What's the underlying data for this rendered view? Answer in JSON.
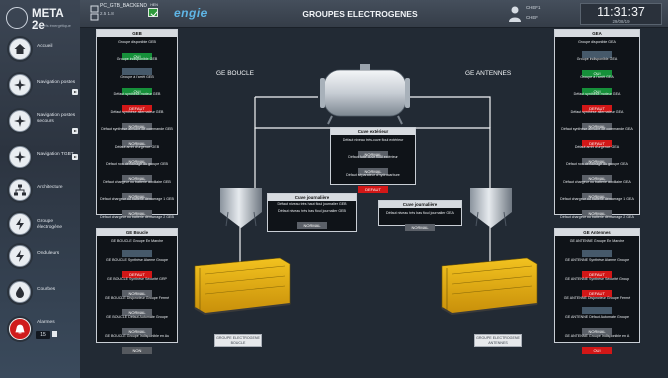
{
  "app": {
    "name": "META 2e",
    "subtitle": "aéronefs énergétique"
  },
  "sidebar": {
    "items": [
      {
        "label": "Accueil",
        "icon": "home-icon",
        "has_arrow": false
      },
      {
        "label": "Navigation postes",
        "icon": "compass-icon",
        "has_arrow": true
      },
      {
        "label": "Navigation postes secours",
        "icon": "compass-icon",
        "has_arrow": true
      },
      {
        "label": "Navigation TGBT",
        "icon": "compass-icon",
        "has_arrow": true
      },
      {
        "label": "Architecture",
        "icon": "network-icon",
        "has_arrow": false
      },
      {
        "label": "Groupe électrogène",
        "icon": "bolt-icon",
        "has_arrow": false
      },
      {
        "label": "Onduleurs",
        "icon": "bolt-icon",
        "has_arrow": false
      },
      {
        "label": "Courbes",
        "icon": "drop-icon",
        "has_arrow": false
      },
      {
        "label": "Alarmes",
        "icon": "alarm-bell-icon",
        "has_arrow": true
      }
    ],
    "alarm_count": "15"
  },
  "header": {
    "station_name": "PC_GTB_BACKEND",
    "version": "2.5  1.8",
    "flag_label": "HEN",
    "brand": "engie",
    "title": "GROUPES ELECTROGENES",
    "user_name": "CHEF1",
    "user_role": "CHEF",
    "time": "11:31:37",
    "date": "29/08/19"
  },
  "diagram": {
    "caption_left": "GE BOUCLE",
    "caption_right": "GE ANTENNES",
    "gen_left_label": "GROUPE ELECTROGENE BOUCLE",
    "gen_right_label": "GROUPE ELECTROGENE ANTENNES"
  },
  "panels": {
    "geb": {
      "title": "GEB",
      "signals": [
        {
          "label": "Groupe disponible GEB",
          "value": "OUI",
          "state": "ok"
        },
        {
          "label": "Groupe indisponible GEB",
          "value": "",
          "state": "blank"
        },
        {
          "label": "Groupe à l'arrêt GEB",
          "value": "OUI",
          "state": "ok"
        },
        {
          "label": "Défaut synthèse moteur GEB",
          "value": "DEFAUT",
          "state": "default"
        },
        {
          "label": "Défaut synthèse alternateur GEB",
          "value": "NORMAL",
          "state": "normal"
        },
        {
          "label": "Défaut synthèse armoire de commande GEB",
          "value": "NORMAL",
          "state": "normal"
        },
        {
          "label": "Défaut arrêt d'urgence GEB",
          "value": "NORMAL",
          "state": "normal"
        },
        {
          "label": "Défaut non démarrage du groupe GEB",
          "value": "NORMAL",
          "state": "normal"
        },
        {
          "label": "Défaut chargeur ou batterie auxiliaire GEB",
          "value": "NORMAL",
          "state": "normal"
        },
        {
          "label": "Défaut chargeur ou batterie démarrage 1 GEB",
          "value": "NORMAL",
          "state": "normal"
        },
        {
          "label": "Défaut chargeur ou batterie démarrage 2 GEB",
          "value": "NORMAL",
          "state": "normal"
        },
        {
          "label": "erreur com GEB",
          "value": "NORMAL",
          "state": "normal"
        }
      ]
    },
    "gea": {
      "title": "GEA",
      "signals": [
        {
          "label": "Groupe disponible GEA",
          "value": "",
          "state": "blank"
        },
        {
          "label": "Groupe indisponible GEA",
          "value": "OUI",
          "state": "ok"
        },
        {
          "label": "Groupe à l'arrêt GEA",
          "value": "OUI",
          "state": "ok"
        },
        {
          "label": "Défaut synthèse moteur GEA",
          "value": "DEFAUT",
          "state": "default"
        },
        {
          "label": "Défaut synthèse alternateur GEA",
          "value": "NORMAL",
          "state": "normal"
        },
        {
          "label": "Défaut synthèse armoire de commande GEA",
          "value": "DEFAUT",
          "state": "default"
        },
        {
          "label": "Défaut arrêt d'urgence GEA",
          "value": "NORMAL",
          "state": "normal"
        },
        {
          "label": "Défaut non démarrage du groupe GEA",
          "value": "NORMAL",
          "state": "normal"
        },
        {
          "label": "Défaut chargeur ou batterie auxiliaire GEA",
          "value": "NORMAL",
          "state": "normal"
        },
        {
          "label": "Défaut chargeur ou batterie démarrage 1 GEA",
          "value": "NORMAL",
          "state": "normal"
        },
        {
          "label": "Défaut chargeur ou batterie démarrage 2 GEA",
          "value": "NORMAL",
          "state": "normal"
        },
        {
          "label": "erreur com GEA",
          "value": "NORMAL",
          "state": "normal"
        }
      ]
    },
    "ge_boucle": {
      "title": "GE Boucle",
      "signals": [
        {
          "label": "GE BOUCLE Groupe En Marche",
          "value": "",
          "state": "blank"
        },
        {
          "label": "GE BOUCLE Synthèse Alarme Groupe",
          "value": "DEFAUT",
          "state": "default"
        },
        {
          "label": "GE BOUCLE Synthèse Sécurité GRP",
          "value": "NORMAL",
          "state": "normal"
        },
        {
          "label": "GE BOUCLE Disjoncteur Groupe Fermé",
          "value": "NORMAL",
          "state": "normal"
        },
        {
          "label": "GE BOUCLE Défaut Automate Groupe",
          "value": "NORMAL",
          "state": "normal"
        },
        {
          "label": "GE BOUCLE Groupe Indisponible en Au",
          "value": "NON",
          "state": "non"
        }
      ]
    },
    "ge_antennes": {
      "title": "GE Antennes",
      "signals": [
        {
          "label": "GE ANTENNE Groupe En Marche",
          "value": "",
          "state": "blank"
        },
        {
          "label": "GE ANTENNE Synthèse Alarme Groupe",
          "value": "DEFAUT",
          "state": "default"
        },
        {
          "label": "GE ANTENNE Synthèse Sécurité Group",
          "value": "DEFAUT",
          "state": "default"
        },
        {
          "label": "GE ANTENNE Disjoncteur Groupe Fermé",
          "value": "",
          "state": "blank"
        },
        {
          "label": "GE ANTENNE Défaut Automate Groupe",
          "value": "NORMAL",
          "state": "normal"
        },
        {
          "label": "GE ANTENNE Groupe Indisponible en A",
          "value": "OUI",
          "state": "default"
        }
      ]
    },
    "cuve_exterieur": {
      "title": "Cuve extérieur",
      "signals": [
        {
          "label": "Défaut niveau très-cuve fioul extérieur",
          "value": "NORMAL",
          "state": "normal"
        },
        {
          "label": "Défaut fuite cuve fioul extérieur",
          "value": "NORMAL",
          "state": "normal"
        },
        {
          "label": "Défaut séparateur d'hydrocarbure",
          "value": "DEFAUT",
          "state": "default"
        }
      ]
    },
    "cuve_journaliere_left": {
      "title": "Cuve journalière",
      "signals": [
        {
          "label": "Défaut niveau très haut fioul journalier GEB",
          "value": "",
          "state": "blank"
        },
        {
          "label": "Défaut niveau très bas fioul journalier GEB",
          "value": "NORMAL",
          "state": "normal"
        }
      ]
    },
    "cuve_journaliere_right": {
      "title": "Cuve journalière",
      "signals": [
        {
          "label": "Défaut niveau très bas fioul journalier GEA",
          "value": "NORMAL",
          "state": "normal"
        }
      ]
    }
  },
  "colors": {
    "ok": "#16903a",
    "default": "#d21717",
    "normal": "#5b6068",
    "brand": "#5fb6e6"
  }
}
